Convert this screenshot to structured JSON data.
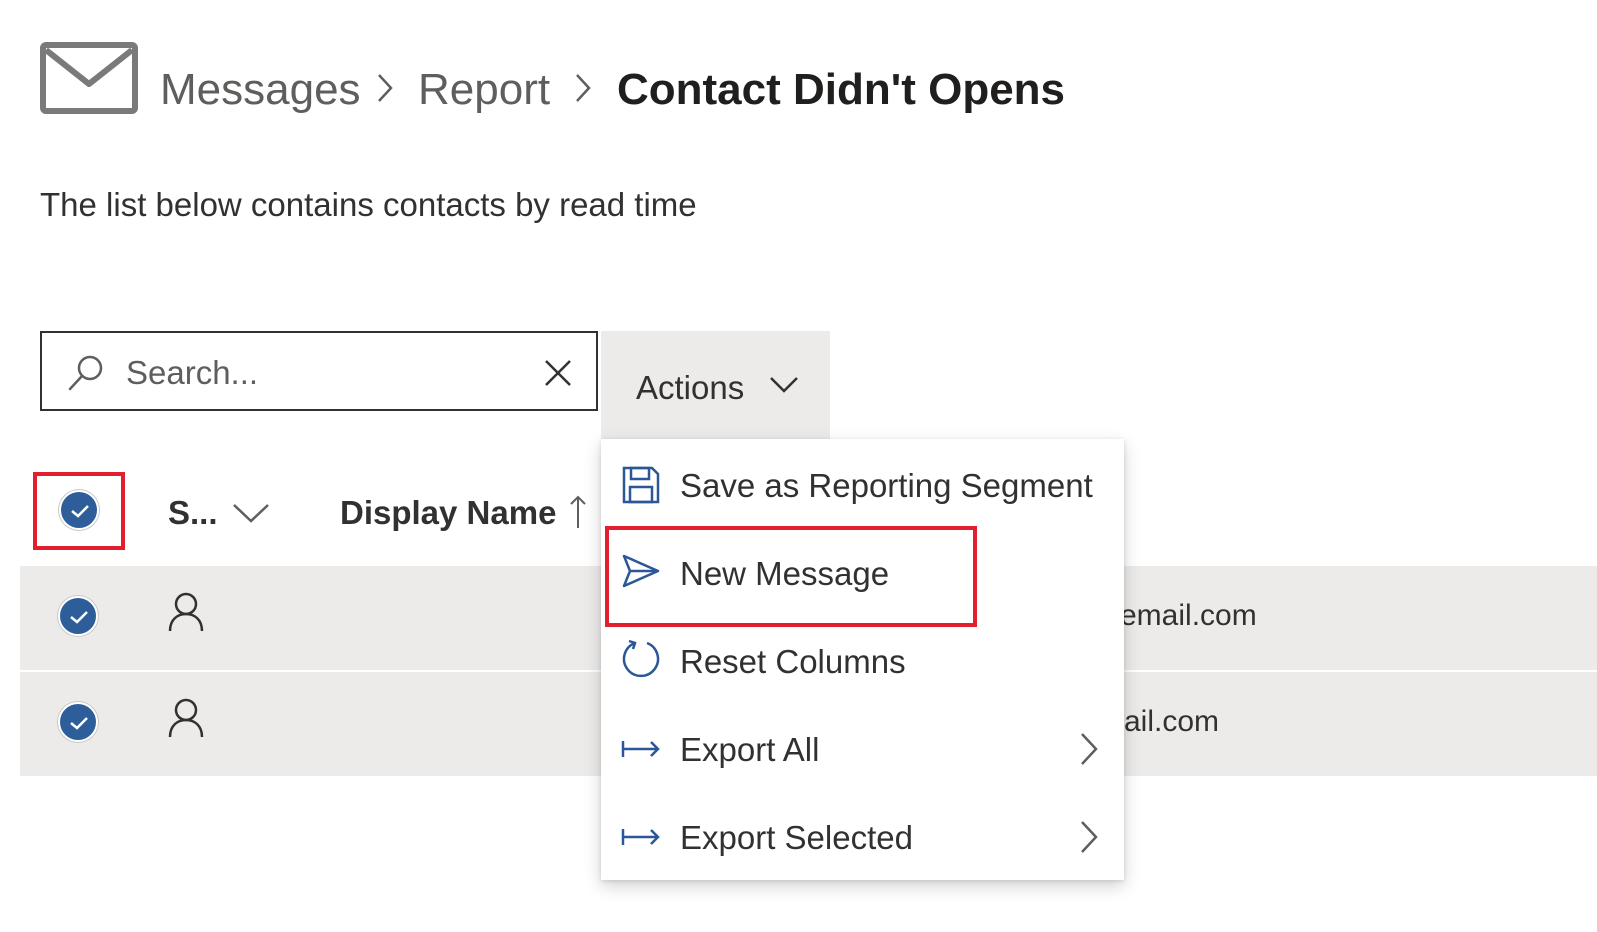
{
  "breadcrumb": {
    "icon": "mail-icon",
    "items": [
      "Messages",
      "Report"
    ],
    "current": "Contact Didn't Opens"
  },
  "subtitle": "The list below contains contacts by read time",
  "search": {
    "placeholder": "Search..."
  },
  "actions": {
    "label": "Actions"
  },
  "table": {
    "headers": {
      "status_short": "S...",
      "display_name": "Display Name"
    },
    "rows": [
      {
        "email_fragment": "email.com"
      },
      {
        "email_fragment": "ail.com"
      }
    ]
  },
  "menu": {
    "items": [
      {
        "label": "Save as Reporting Segment",
        "icon": "save-icon"
      },
      {
        "label": "New Message",
        "icon": "send-icon"
      },
      {
        "label": "Reset Columns",
        "icon": "refresh-icon"
      },
      {
        "label": "Export All",
        "icon": "export-icon",
        "has_submenu": true
      },
      {
        "label": "Export Selected",
        "icon": "export-icon",
        "has_submenu": true
      }
    ]
  },
  "colors": {
    "accent": "#2e5e9a",
    "highlight": "#e0202e",
    "row_bg": "#edebe9",
    "icon_blue": "#2b5797"
  }
}
